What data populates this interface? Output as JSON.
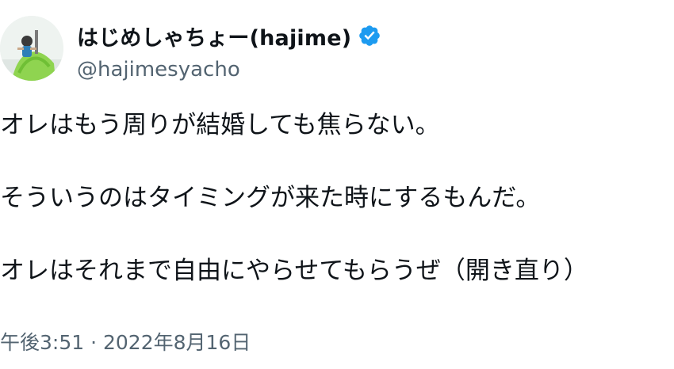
{
  "author": {
    "display_name": "はじめしゃちょー(hajime)",
    "handle": "@hajimesyacho",
    "verified": true,
    "verified_icon": "verified-badge-icon",
    "avatar": "avatar-photo"
  },
  "tweet": {
    "lines": [
      "オレはもう周りが結婚しても焦らない。",
      "そういうのはタイミングが来た時にするもんだ。",
      "オレはそれまで自由にやらせてもらうぜ（開き直り）"
    ]
  },
  "meta": {
    "timestamp": "午後3:51 · 2022年8月16日"
  },
  "colors": {
    "text": "#0f1419",
    "secondary": "#536471",
    "verified": "#1d9bf0"
  }
}
